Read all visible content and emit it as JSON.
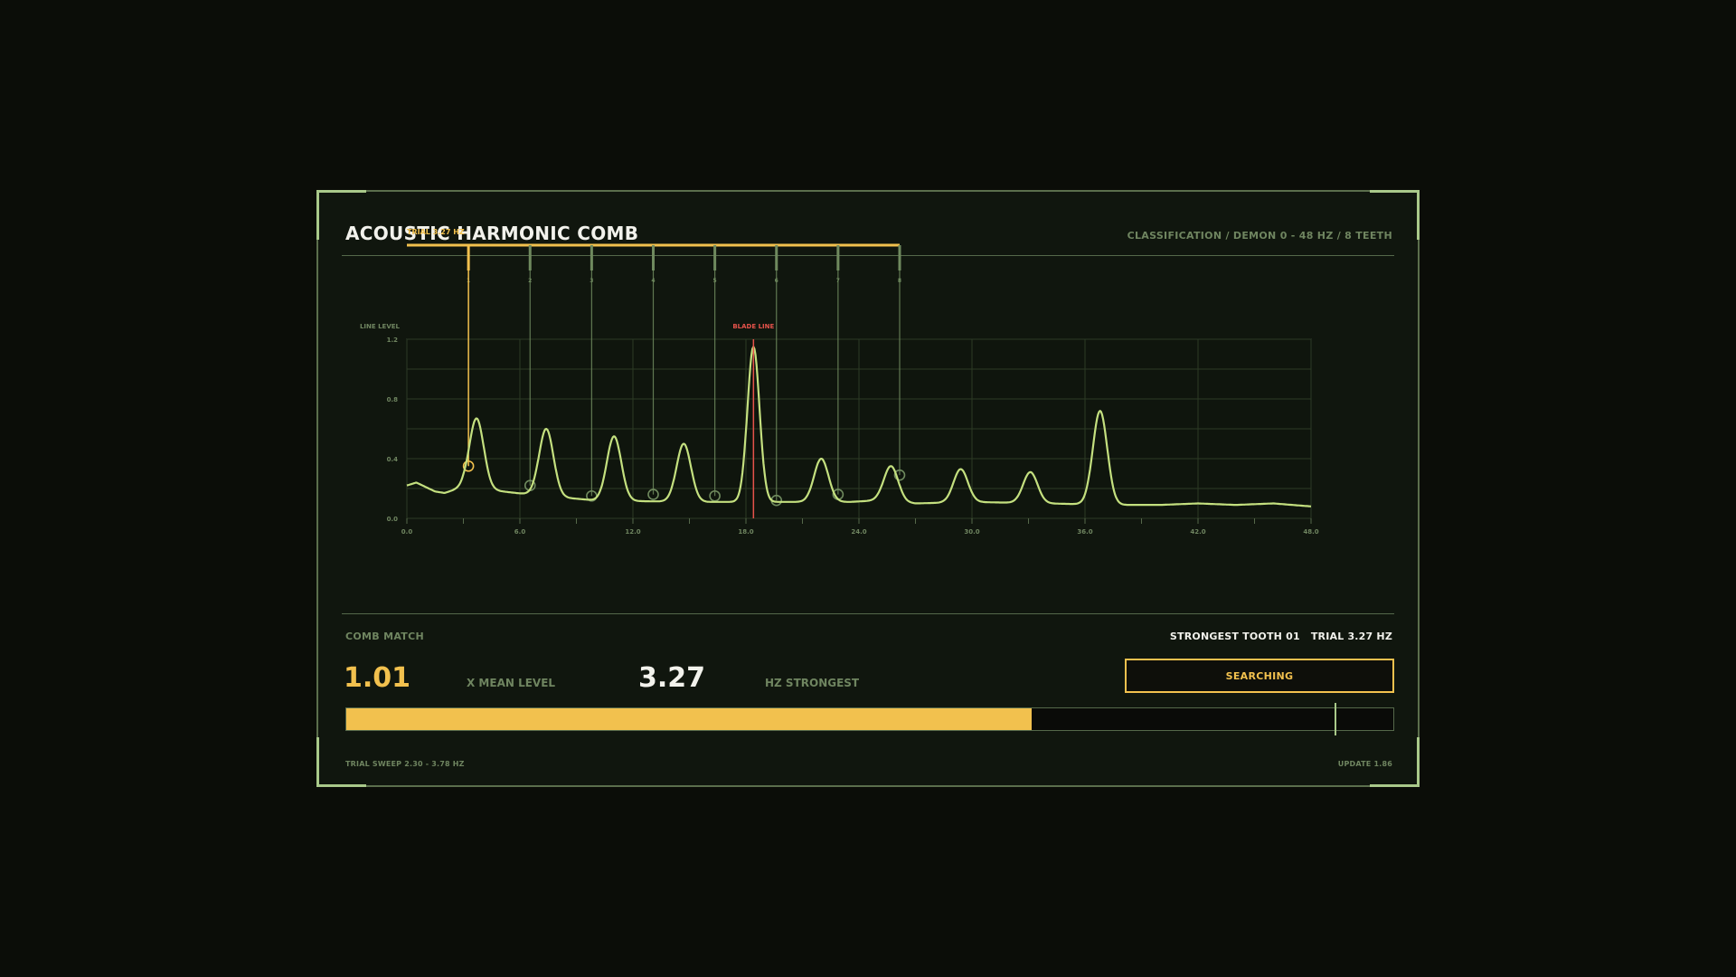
{
  "header": {
    "title": "ACOUSTIC HARMONIC COMB",
    "classification": "CLASSIFICATION / DEMON 0 - 48 HZ / 8 TEETH"
  },
  "chart_data": {
    "type": "line",
    "ylabel": "LINE LEVEL",
    "xlim": [
      0,
      48
    ],
    "ylim": [
      0,
      1.2
    ],
    "x_ticks": [
      0,
      6,
      12,
      18,
      24,
      30,
      36,
      42,
      48
    ],
    "x_tick_labels": [
      "0.0",
      "6.0",
      "12.0",
      "18.0",
      "24.0",
      "30.0",
      "36.0",
      "42.0",
      "48.0"
    ],
    "y_ticks": [
      0,
      0.4,
      0.8,
      1.2
    ],
    "y_tick_labels": [
      "0.0",
      "0.4",
      "0.8",
      "1.2"
    ],
    "grid": true,
    "baseline": [
      [
        0,
        0.22
      ],
      [
        0.5,
        0.24
      ],
      [
        1.0,
        0.21
      ],
      [
        1.5,
        0.18
      ],
      [
        2.0,
        0.17
      ],
      [
        2.5,
        0.19
      ],
      [
        3.0,
        0.21
      ],
      [
        6.5,
        0.16
      ],
      [
        10.0,
        0.12
      ],
      [
        15.0,
        0.11
      ],
      [
        20.0,
        0.11
      ],
      [
        23.5,
        0.11
      ],
      [
        25.0,
        0.12
      ],
      [
        27.0,
        0.1
      ],
      [
        30.0,
        0.11
      ],
      [
        34.0,
        0.1
      ],
      [
        37.5,
        0.09
      ],
      [
        40.0,
        0.09
      ],
      [
        42.0,
        0.1
      ],
      [
        44.0,
        0.09
      ],
      [
        46.0,
        0.1
      ],
      [
        48.0,
        0.08
      ]
    ],
    "peaks": [
      {
        "x": 3.7,
        "y": 0.67
      },
      {
        "x": 7.4,
        "y": 0.6
      },
      {
        "x": 11.0,
        "y": 0.55
      },
      {
        "x": 14.7,
        "y": 0.5
      },
      {
        "x": 18.4,
        "y": 1.15
      },
      {
        "x": 22.0,
        "y": 0.4
      },
      {
        "x": 25.7,
        "y": 0.35
      },
      {
        "x": 29.4,
        "y": 0.33
      },
      {
        "x": 33.1,
        "y": 0.31
      },
      {
        "x": 36.8,
        "y": 0.72
      }
    ],
    "trial": {
      "label": "TRIAL 3.27 HZ",
      "fundamental_hz": 3.27,
      "teeth": 8,
      "tooth_labels": [
        "1",
        "2",
        "3",
        "4",
        "5",
        "6",
        "7",
        "8"
      ],
      "tooth_levels": [
        0.35,
        0.22,
        0.15,
        0.16,
        0.15,
        0.12,
        0.16,
        0.29
      ]
    },
    "blade_line": {
      "label": "BLADE LINE",
      "x": 18.4
    }
  },
  "comb": {
    "label": "COMB MATCH",
    "strongest_tooth": "STRONGEST TOOTH 01",
    "strongest_trial": "TRIAL 3.27 HZ",
    "mean_value": "1.01",
    "mean_label": "X MEAN LEVEL",
    "hz_value": "3.27",
    "hz_label": "HZ STRONGEST",
    "status_button": "SEARCHING",
    "progress_fraction": 0.655,
    "marker_fraction": 0.945,
    "sweep_label": "TRIAL SWEEP 2.30 - 3.78 HZ",
    "update_label": "UPDATE 1.86"
  },
  "colors": {
    "accent_yellow": "#f2c14e",
    "trace_green": "#c4e07f",
    "comb_green": "#6f8a5e",
    "blade_red": "#e5534b",
    "panel_bg": "#10160e"
  }
}
